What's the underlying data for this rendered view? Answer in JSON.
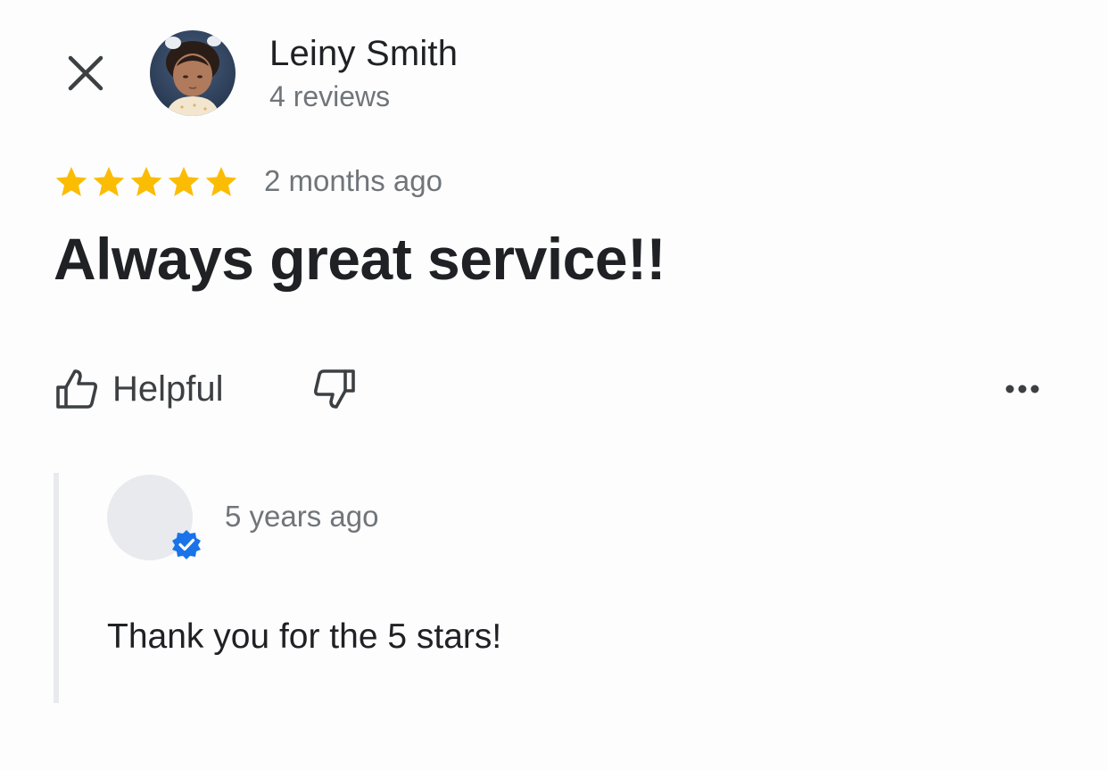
{
  "review": {
    "reviewer_name": "Leiny Smith",
    "review_count": "4 reviews",
    "rating": 5,
    "rating_max": 5,
    "date": "2 months ago",
    "text": "Always great service!!",
    "star_color": "#fbbc04"
  },
  "actions": {
    "helpful_label": "Helpful",
    "close_icon": "close-icon",
    "dislike_icon": "thumbs-down-icon",
    "more_icon": "more-horizontal-icon"
  },
  "reply": {
    "date": "5 years ago",
    "text": "Thank you for the 5 stars!",
    "badge_color": "#1a73e8"
  }
}
